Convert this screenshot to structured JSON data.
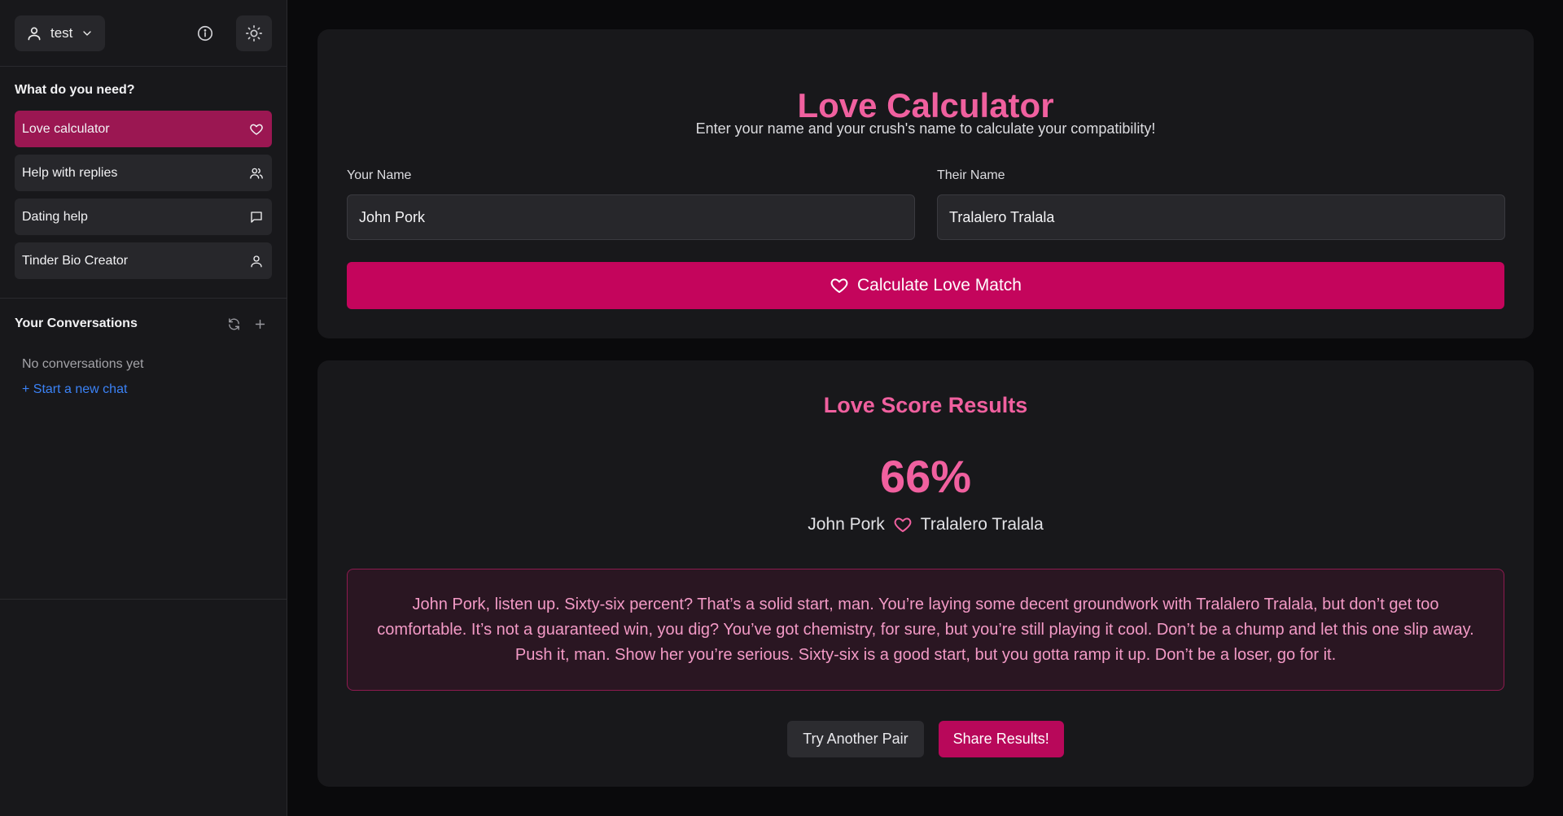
{
  "sidebar": {
    "user": {
      "name": "test",
      "icon": "user-icon"
    },
    "info_icon": "info-icon",
    "theme_icon": "sun-icon",
    "section_heading": "What do you need?",
    "items": [
      {
        "label": "Love calculator",
        "icon": "heart-icon",
        "active": true
      },
      {
        "label": "Help with replies",
        "icon": "users-icon",
        "active": false
      },
      {
        "label": "Dating help",
        "icon": "message-icon",
        "active": false
      },
      {
        "label": "Tinder Bio Creator",
        "icon": "user-icon",
        "active": false
      }
    ],
    "conversations": {
      "heading": "Your Conversations",
      "empty_text": "No conversations yet",
      "new_chat": "+ Start a new chat"
    }
  },
  "calculator": {
    "title": "Love Calculator",
    "subtitle": "Enter your name and your crush's name to calculate your compatibility!",
    "your_name_label": "Your Name",
    "your_name_value": "John Pork",
    "their_name_label": "Their Name",
    "their_name_value": "Tralalero Tralala",
    "button_label": "Calculate Love Match"
  },
  "results": {
    "title": "Love Score Results",
    "score": "66%",
    "name1": "John Pork",
    "name2": "Tralalero Tralala",
    "message": "John Pork, listen up. Sixty-six percent? That’s a solid start, man. You’re laying some decent groundwork with Tralalero Tralala, but don’t get too comfortable. It’s not a guaranteed win, you dig? You’ve got chemistry, for sure, but you’re still playing it cool. Don’t be a chump and let this one slip away. Push it, man. Show her you’re serious. Sixty-six is a good start, but you gotta ramp it up. Don’t be a loser, go for it.",
    "try_again": "Try Another Pair",
    "share": "Share Results!"
  },
  "colors": {
    "accent_pink": "#f0609f",
    "button_pink": "#c4055c",
    "active_nav": "#9b1752",
    "link_blue": "#3b82f6"
  }
}
